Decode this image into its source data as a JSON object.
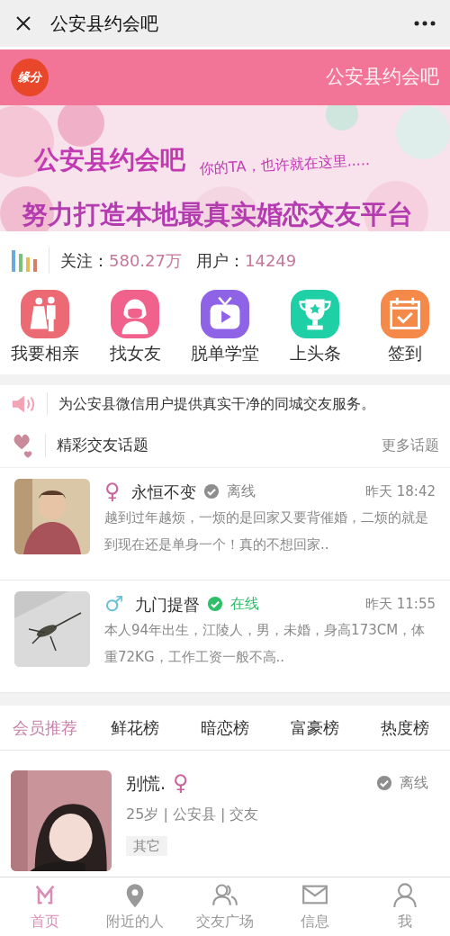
{
  "window": {
    "title": "公安县约会吧"
  },
  "header": {
    "logo": "缘分",
    "title": "公安县约会吧"
  },
  "banner": {
    "title": "公安县约会吧",
    "tagline": "你的TA，也许就在这里.....",
    "slogan": "努力打造本地最真实婚恋交友平台"
  },
  "stats": [
    {
      "label": "关注：",
      "value": "580.27万"
    },
    {
      "label": "用户：",
      "value": "14249"
    }
  ],
  "shortcuts": [
    {
      "label": "我要相亲",
      "kind": "couple",
      "color": "#ec6a73"
    },
    {
      "label": "找女友",
      "kind": "girl",
      "color": "#f0618c"
    },
    {
      "label": "脱单学堂",
      "kind": "tv",
      "color": "#8f63e6"
    },
    {
      "label": "上头条",
      "kind": "trophy",
      "color": "#1fcfa6"
    },
    {
      "label": "签到",
      "kind": "calendar",
      "color": "#f5894a"
    }
  ],
  "notice": "为公安县微信用户提供真实干净的同城交友服务。",
  "topics": {
    "title": "精彩交友话题",
    "more": "更多话题",
    "items": [
      {
        "gender": "♀",
        "name": "永恒不变",
        "online": false,
        "status": "离线",
        "time": "昨天 18:42",
        "text": "越到过年越烦，一烦的是回家又要背催婚，二烦的就是到现在还是单身一个！真的不想回家.."
      },
      {
        "gender": "♂",
        "name": "九门提督",
        "online": true,
        "status": "在线",
        "time": "昨天 11:55",
        "text": "本人94年出生，江陵人，男，未婚，身高173CM，体重72KG，工作工资一般不高.."
      }
    ]
  },
  "rank_tabs": [
    {
      "label": "会员推荐",
      "selected": true
    },
    {
      "label": "鲜花榜",
      "selected": false
    },
    {
      "label": "暗恋榜",
      "selected": false
    },
    {
      "label": "富豪榜",
      "selected": false
    },
    {
      "label": "热度榜",
      "selected": false
    }
  ],
  "members": [
    {
      "name": "别慌.",
      "gender": "♀",
      "online": false,
      "status": "离线",
      "info": "25岁 | 公安县 | 交友",
      "tag": "其它"
    }
  ],
  "nav": [
    {
      "label": "首页",
      "kind": "home",
      "selected": true
    },
    {
      "label": "附近的人",
      "kind": "pin",
      "selected": false
    },
    {
      "label": "交友广场",
      "kind": "people",
      "selected": false
    },
    {
      "label": "信息",
      "kind": "mail",
      "selected": false
    },
    {
      "label": "我",
      "kind": "user",
      "selected": false
    }
  ]
}
